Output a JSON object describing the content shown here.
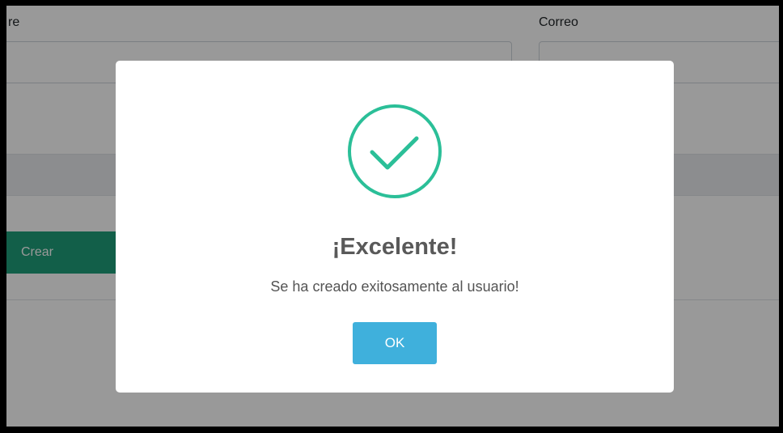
{
  "background": {
    "name_label_partial": "re",
    "email_label": "Correo",
    "create_button_label": "Crear"
  },
  "modal": {
    "icon": "success-check-icon",
    "title": "¡Excelente!",
    "message": "Se ha creado exitosamente al usuario!",
    "ok_button_label": "OK"
  },
  "colors": {
    "success": "#2bbf98",
    "ok_button": "#3fb0dc",
    "create_button": "#1e9e7a",
    "overlay": "rgba(0,0,0,0.4)"
  }
}
